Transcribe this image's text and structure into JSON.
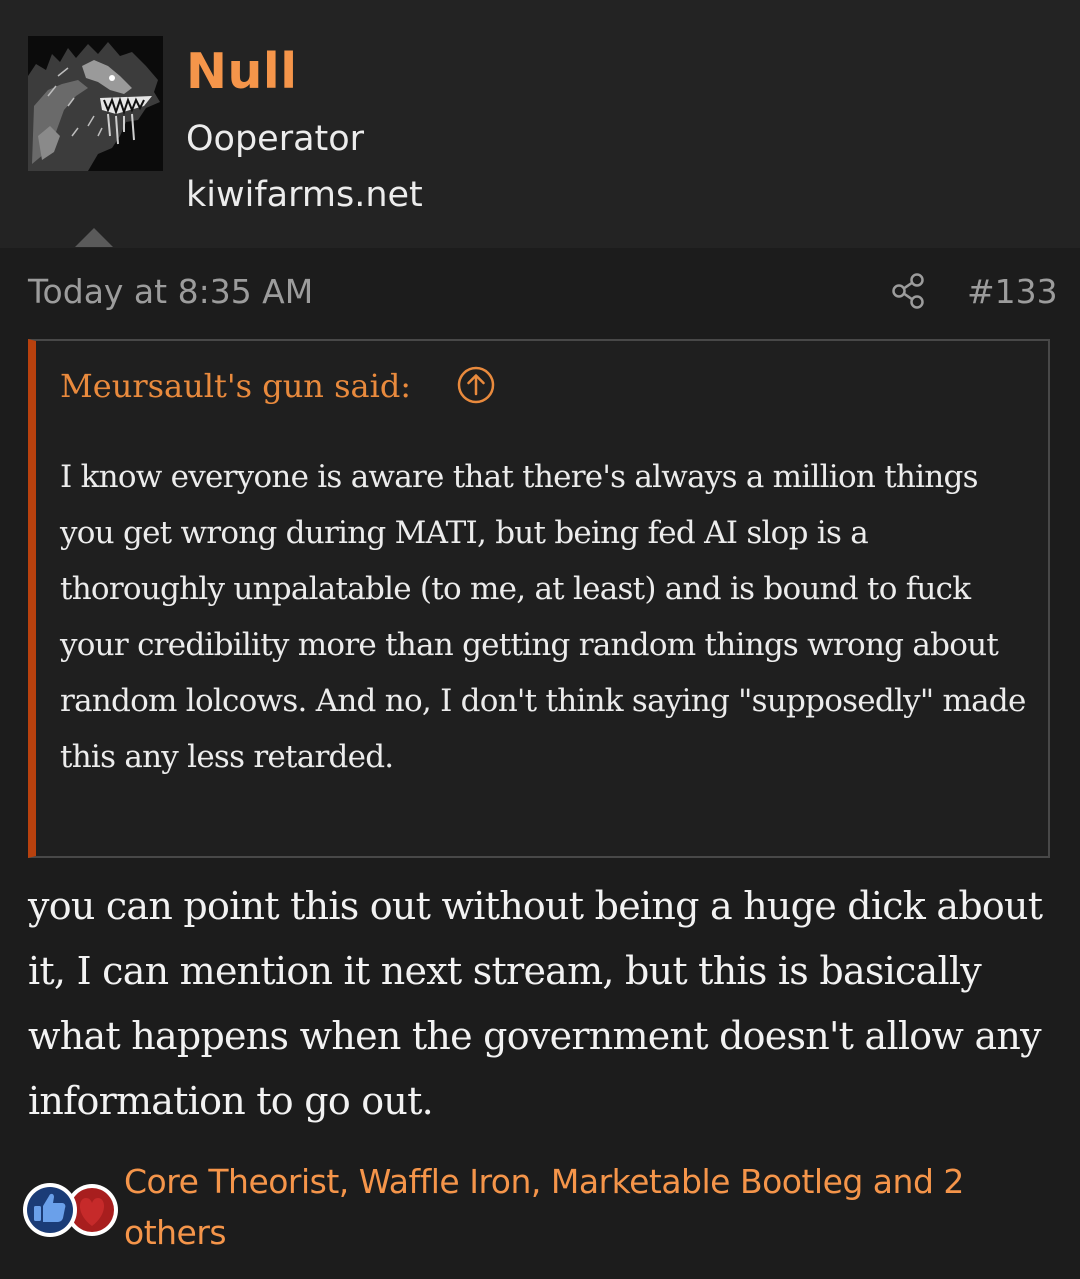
{
  "user": {
    "name": "Null",
    "title": "Ooperator",
    "site": "kiwifarms.net"
  },
  "post": {
    "date": "Today at 8:35 AM",
    "number": "#133"
  },
  "quote": {
    "attribution": "Meursault's gun said:",
    "text": "I know everyone is aware that there's always a million things you get wrong during MATI, but being fed AI slop is a thoroughly unpalatable (to me, at least) and is bound to fuck your credibility more than getting random things wrong about random lolcows. And no, I don't think saying \"supposedly\" made this any less retarded."
  },
  "body": {
    "text": "you can point this out without being a huge dick about it, I can mention it next stream, but this is basically what happens when the government doesn't allow any information to go out."
  },
  "reactions": {
    "icons": [
      "thumbs-up-icon",
      "heart-icon"
    ],
    "summary": "Core Theorist, Waffle Iron, Marketable Bootleg and 2 others"
  },
  "colors": {
    "accent": "#f5954a",
    "quote_bar": "#b8410e",
    "background": "#1c1c1c",
    "header_background": "#232323"
  }
}
